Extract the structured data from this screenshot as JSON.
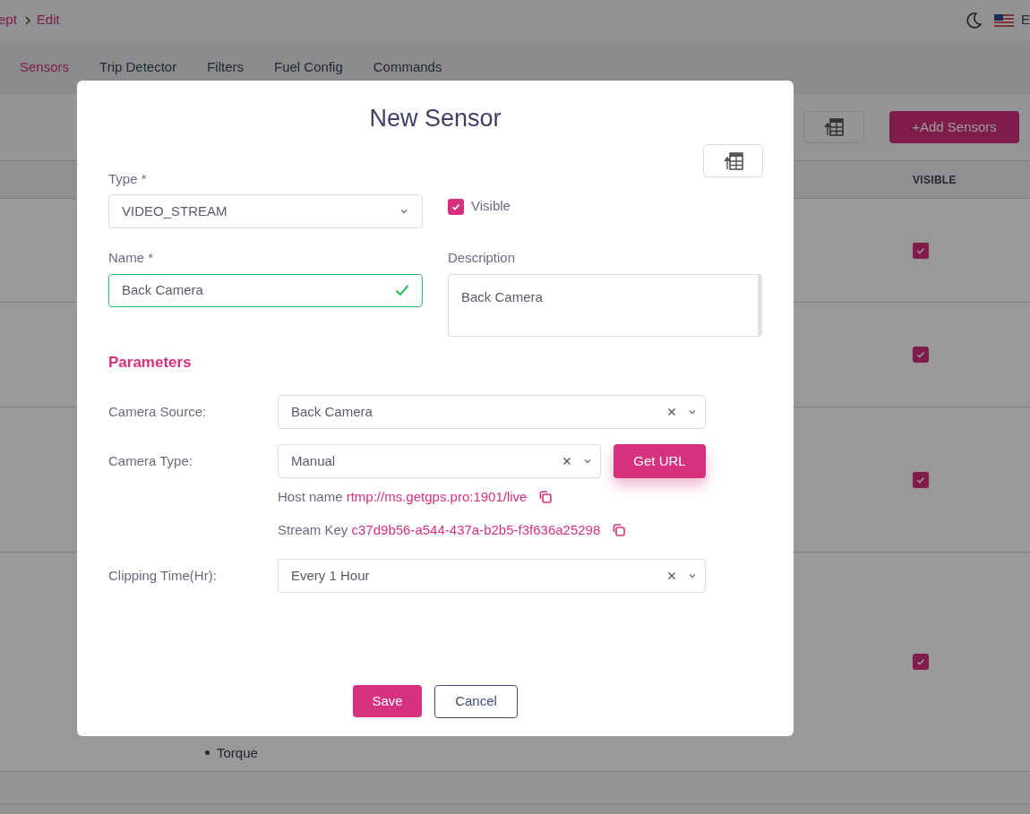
{
  "breadcrumb": [
    "ept",
    "Edit"
  ],
  "header": {
    "language": "E"
  },
  "tabs": [
    {
      "label": "Sensors",
      "selected": true
    },
    {
      "label": "Trip Detector",
      "selected": false
    },
    {
      "label": "Filters",
      "selected": false
    },
    {
      "label": "Fuel Config",
      "selected": false
    },
    {
      "label": "Commands",
      "selected": false
    }
  ],
  "toolbar": {
    "add_button": "+Add Sensors"
  },
  "table": {
    "columns": [
      "VISIBLE"
    ],
    "rows": [
      {
        "visible": true
      },
      {
        "visible": true
      },
      {
        "visible": true
      },
      {
        "visible": true
      }
    ],
    "list_items": [
      "Torque"
    ]
  },
  "modal": {
    "title": "New Sensor",
    "type": {
      "label": "Type *",
      "value": "VIDEO_STREAM"
    },
    "visible": {
      "label": "Visible",
      "checked": true
    },
    "name": {
      "label": "Name *",
      "value": "Back Camera",
      "valid": true
    },
    "description": {
      "label": "Description",
      "value": "Back Camera"
    },
    "parameters_heading": "Parameters",
    "params": [
      {
        "label": "Camera Source:",
        "value": "Back Camera"
      },
      {
        "label": "Camera Type:",
        "value": "Manual",
        "button": "Get URL"
      },
      {
        "kind": "info",
        "label": "Host name",
        "value": "rtmp://ms.getgps.pro:1901/live"
      },
      {
        "kind": "info",
        "label": "Stream Key",
        "value": "c37d9b56-a544-437a-b2b5-f3f636a25298"
      },
      {
        "label": "Clipping Time(Hr):",
        "value": "Every 1 Hour"
      }
    ],
    "buttons": {
      "save": "Save",
      "cancel": "Cancel"
    }
  }
}
